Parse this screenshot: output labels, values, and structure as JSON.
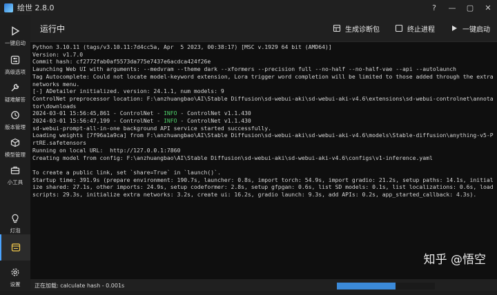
{
  "window": {
    "title": "绘世 2.8.0",
    "controls": [
      "?",
      "—",
      "▢",
      "✕"
    ]
  },
  "sidebar": {
    "items": [
      {
        "label": "一键启动",
        "icon": "play-icon"
      },
      {
        "label": "高级选项",
        "icon": "sliders-icon"
      },
      {
        "label": "疑难解答",
        "icon": "wrench-icon"
      },
      {
        "label": "版本管理",
        "icon": "history-icon"
      },
      {
        "label": "模型管理",
        "icon": "cube-icon"
      },
      {
        "label": "小工具",
        "icon": "toolbox-icon"
      },
      {
        "label": "灯泡",
        "icon": "bulb-icon"
      },
      {
        "label": "",
        "icon": "console-icon"
      },
      {
        "label": "设置",
        "icon": "gear-icon"
      }
    ]
  },
  "header": {
    "status": "运行中",
    "diag_label": "生成诊断包",
    "stop_label": "终止进程",
    "launch_label": "一键启动"
  },
  "console": {
    "lines": [
      "Python 3.10.11 (tags/v3.10.11:7d4cc5a, Apr  5 2023, 00:38:17) [MSC v.1929 64 bit (AMD64)]",
      "Version: v1.7.0",
      "Commit hash: cf2772fab0af5573da775e7437e6acdca424f26e",
      "Launching Web UI with arguments: --medvram --theme dark --xformers --precision full --no-half --no-half-vae --api --autolaunch",
      "Tag Autocomplete: Could not locate model-keyword extension, Lora trigger word completion will be limited to those added through the extra networks menu.",
      "[-] ADetailer initialized. version: 24.1.1, num models: 9",
      "ControlNet preprocessor location: F:\\anzhuangbao\\AI\\Stable Diffusion\\sd-webui-aki\\sd-webui-aki-v4.6\\extensions\\sd-webui-controlnet\\annotator\\downloads",
      {
        "pre": "2024-03-01 15:56:45,861 - ControlNet - ",
        "info": "INFO",
        "post": " - ControlNet v1.1.430"
      },
      {
        "pre": "2024-03-01 15:56:47,199 - ControlNet - ",
        "info": "INFO",
        "post": " - ControlNet v1.1.430"
      },
      "sd-webui-prompt-all-in-one background API service started successfully.",
      "Loading weights [7f96a1a9ca] from F:\\anzhuangbao\\AI\\Stable Diffusion\\sd-webui-aki\\sd-webui-aki-v4.6\\models\\Stable-diffusion\\anything-v5-PrtRE.safetensors",
      "Running on local URL:  http://127.0.0.1:7860",
      "Creating model from config: F:\\anzhuangbao\\AI\\Stable Diffusion\\sd-webui-aki\\sd-webui-aki-v4.6\\configs\\v1-inference.yaml",
      "",
      "To create a public link, set `share=True` in `launch()`.",
      "Startup time: 391.9s (prepare environment: 190.7s, launcher: 0.8s, import torch: 54.9s, import gradio: 21.2s, setup paths: 14.1s, initialize shared: 27.1s, other imports: 24.9s, setup codeformer: 2.8s, setup gfpgan: 0.6s, list SD models: 0.1s, list localizations: 0.6s, load scripts: 29.3s, initialize extra networks: 3.2s, create ui: 16.2s, gradio launch: 9.3s, add APIs: 0.2s, app_started_callback: 4.3s)."
    ]
  },
  "watermark": "知乎 @悟空",
  "statusbar": {
    "message": "正在加载: calculate hash - 0.001s",
    "progress": 0.6
  },
  "colors": {
    "accent": "#4aa3ff",
    "info": "#4fd06a",
    "progress": "#3b8ad9"
  }
}
